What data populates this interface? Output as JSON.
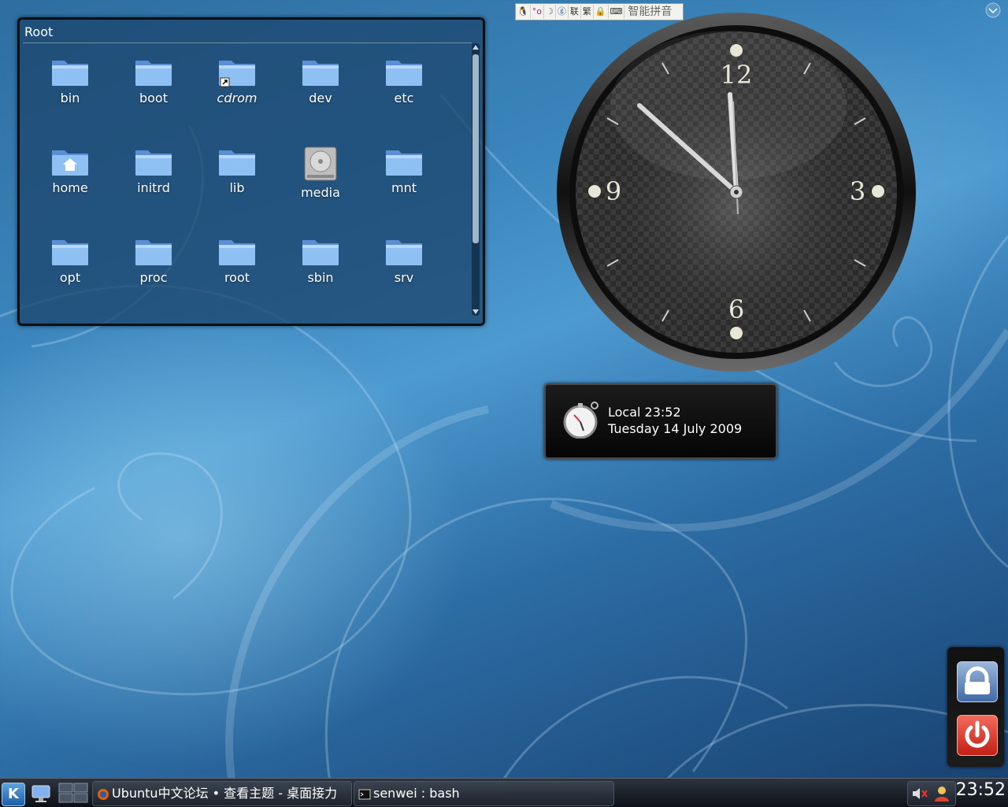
{
  "folderview": {
    "title": "Root",
    "items": [
      {
        "label": "bin",
        "icon": "folder-icon"
      },
      {
        "label": "boot",
        "icon": "folder-icon"
      },
      {
        "label": "cdrom",
        "icon": "folder-link-icon"
      },
      {
        "label": "dev",
        "icon": "folder-icon"
      },
      {
        "label": "etc",
        "icon": "folder-icon"
      },
      {
        "label": "home",
        "icon": "home-folder-icon"
      },
      {
        "label": "initrd",
        "icon": "folder-icon"
      },
      {
        "label": "lib",
        "icon": "folder-icon"
      },
      {
        "label": "media",
        "icon": "hard-drive-icon"
      },
      {
        "label": "mnt",
        "icon": "folder-icon"
      },
      {
        "label": "opt",
        "icon": "folder-icon"
      },
      {
        "label": "proc",
        "icon": "folder-icon"
      },
      {
        "label": "root",
        "icon": "folder-icon"
      },
      {
        "label": "sbin",
        "icon": "folder-icon"
      },
      {
        "label": "srv",
        "icon": "folder-icon"
      }
    ]
  },
  "imbar": {
    "mode_label": "联",
    "trad_label": "繁",
    "ime_name": "智能拼音"
  },
  "clock": {
    "numerals": [
      "12",
      "3",
      "6",
      "9"
    ],
    "time": "23:52"
  },
  "tooltip": {
    "line1": "Local 23:52",
    "line2": "Tuesday 14 July 2009"
  },
  "taskbar": {
    "kmenu_label": "K",
    "tasks": [
      {
        "label": "Ubuntu中文论坛 • 查看主题 - 桌面接力",
        "icon": "firefox-icon"
      },
      {
        "label": "senwei : bash",
        "icon": "terminal-icon"
      }
    ],
    "clock": "23:52"
  },
  "colors": {
    "desktop_blue": "#3b86bd",
    "folder_blue": "#7fb2ee",
    "logout_red": "#d63426",
    "lock_blue": "#5b82bb"
  }
}
